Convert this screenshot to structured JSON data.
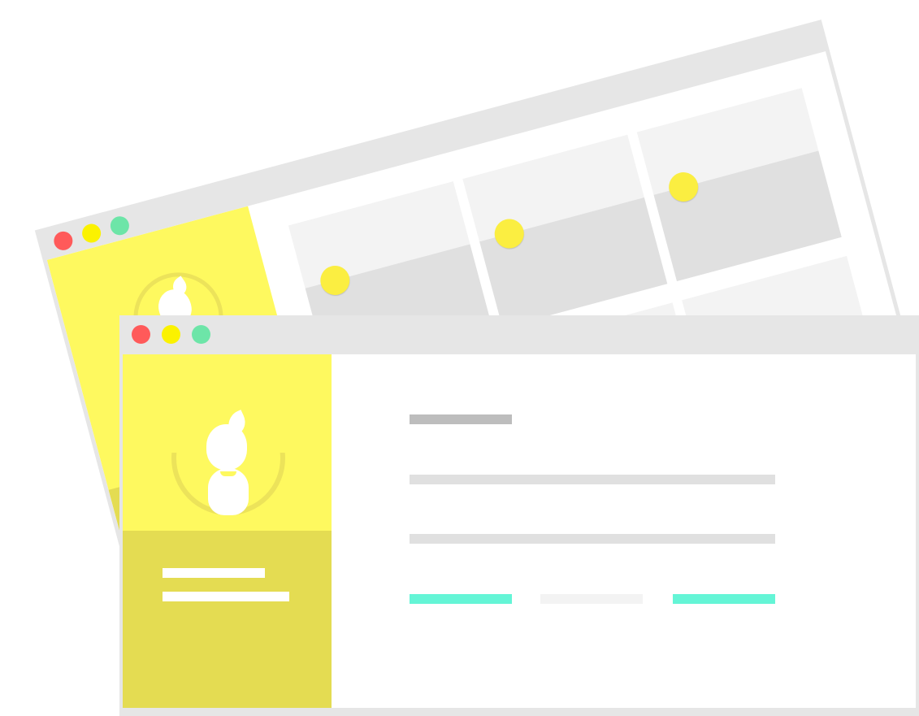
{
  "colors": {
    "window_frame": "#e6e6e6",
    "sidebar_yellow": "#fef95f",
    "sidebar_dark_yellow": "#e4dc52",
    "dot_red": "#ff5a5a",
    "dot_yellow": "#fbf200",
    "dot_green": "#6de5a8",
    "heading_bar": "#bdbdbd",
    "text_bar": "#e0e0e0",
    "accent_teal": "#64f5d6",
    "muted_bar": "#f3f3f3",
    "card_dot": "#fbee41"
  },
  "icons": {
    "close": "close-dot-icon",
    "minimize": "minimize-dot-icon",
    "maximize": "maximize-dot-icon",
    "avatar": "user-avatar-icon"
  }
}
